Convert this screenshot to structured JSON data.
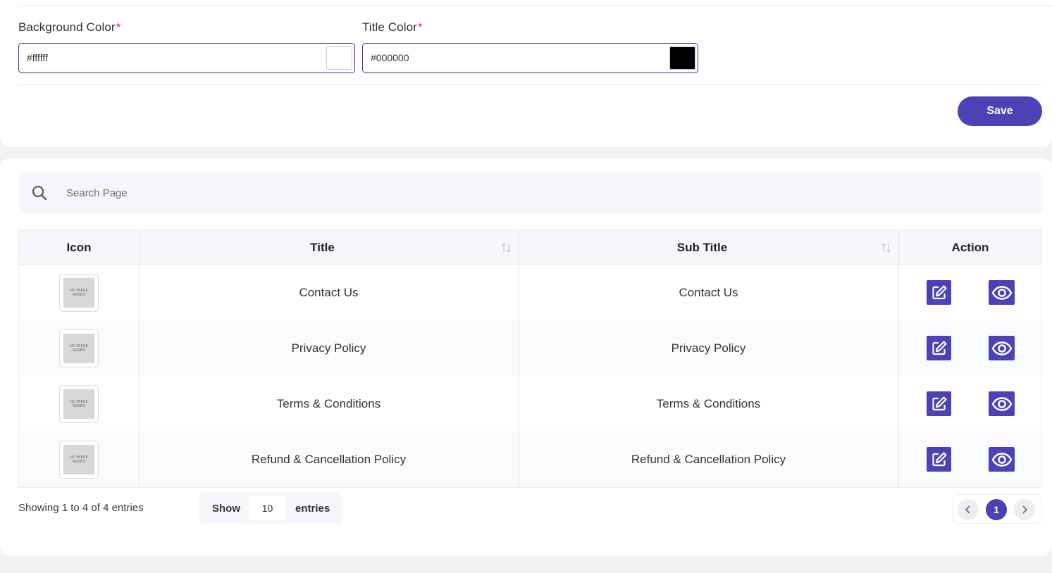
{
  "settings": {
    "background_color": {
      "label": "Background Color",
      "required_mark": "*",
      "value": "#ffffff"
    },
    "title_color": {
      "label": "Title Color",
      "required_mark": "*",
      "value": "#000000"
    },
    "save_label": "Save"
  },
  "search": {
    "placeholder": "Search Page"
  },
  "table": {
    "headers": {
      "icon": "Icon",
      "title": "Title",
      "sub_title": "Sub Title",
      "action": "Action"
    },
    "rows": [
      {
        "thumb_text": "NO IMAGE ADDED",
        "title": "Contact Us",
        "sub_title": "Contact Us"
      },
      {
        "thumb_text": "NO IMAGE ADDED",
        "title": "Privacy Policy",
        "sub_title": "Privacy Policy"
      },
      {
        "thumb_text": "NO IMAGE ADDED",
        "title": "Terms & Conditions",
        "sub_title": "Terms & Conditions"
      },
      {
        "thumb_text": "NO IMAGE ADDED",
        "title": "Refund & Cancellation Policy",
        "sub_title": "Refund & Cancellation Policy"
      }
    ],
    "row_icons": {
      "edit": "edit-icon",
      "view": "eye-icon"
    }
  },
  "footer": {
    "showing": "Showing 1 to 4 of 4 entries",
    "show_label": "Show",
    "page_length": "10",
    "entries_label": "entries",
    "current_page": "1"
  },
  "colors": {
    "accent": "#4c41b5",
    "field_border": "#3c348f",
    "required": "#d93030"
  }
}
